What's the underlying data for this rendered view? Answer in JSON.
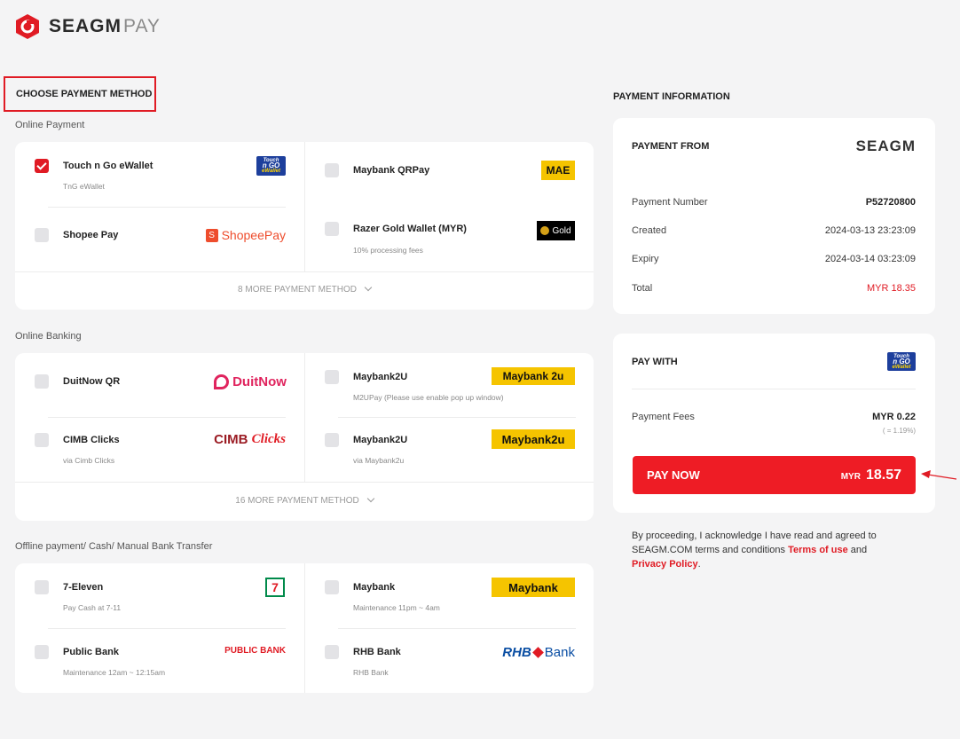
{
  "brand": {
    "logo_main": "SEAGM",
    "logo_pay": "PAY"
  },
  "left": {
    "choose_title": "CHOOSE PAYMENT METHOD",
    "online_payment": {
      "label": "Online Payment",
      "options": [
        {
          "name": "Touch n Go eWallet",
          "sub": "TnG eWallet",
          "checked": true,
          "logo": "Touch n GO eWallet"
        },
        {
          "name": "Maybank QRPay",
          "sub": "",
          "checked": false,
          "logo": "MAE"
        },
        {
          "name": "Shopee Pay",
          "sub": "",
          "checked": false,
          "logo": "ShopeePay"
        },
        {
          "name": "Razer Gold Wallet (MYR)",
          "sub": "10% processing fees",
          "checked": false,
          "logo": "Gold"
        }
      ],
      "more": "8 MORE PAYMENT METHOD"
    },
    "online_banking": {
      "label": "Online Banking",
      "options": [
        {
          "name": "DuitNow QR",
          "sub": "",
          "logo": "DuitNow"
        },
        {
          "name": "Maybank2U",
          "sub": "M2UPay (Please use enable pop up window)",
          "logo": "Maybank 2u"
        },
        {
          "name": "CIMB Clicks",
          "sub": "via Cimb Clicks",
          "logo_a": "CIMB",
          "logo_b": "Clicks"
        },
        {
          "name": "Maybank2U",
          "sub": "via Maybank2u",
          "logo": "Maybank2u"
        }
      ],
      "more": "16 MORE PAYMENT METHOD"
    },
    "offline": {
      "label": "Offline payment/ Cash/ Manual Bank Transfer",
      "options": [
        {
          "name": "7-Eleven",
          "sub": "Pay Cash at 7-11",
          "logo": "7"
        },
        {
          "name": "Maybank",
          "sub": "Maintenance 11pm ~ 4am",
          "logo": "Maybank"
        },
        {
          "name": "Public Bank",
          "sub": "Maintenance 12am ~ 12:15am",
          "logo": "PUBLIC BANK"
        },
        {
          "name": "RHB Bank",
          "sub": "RHB Bank",
          "logo_a": "RHB",
          "logo_b": "Bank"
        }
      ]
    }
  },
  "right": {
    "title": "PAYMENT INFORMATION",
    "from_label": "PAYMENT FROM",
    "from_logo": "SEAGM",
    "rows": [
      {
        "label": "Payment Number",
        "value": "P52720800"
      },
      {
        "label": "Created",
        "value": "2024-03-13 23:23:09"
      },
      {
        "label": "Expiry",
        "value": "2024-03-14 03:23:09"
      },
      {
        "label": "Total",
        "value": "MYR 18.35"
      }
    ],
    "pay_with_label": "PAY WITH",
    "fees_label": "Payment Fees",
    "fees_value": "MYR 0.22",
    "fees_pct": "( = 1.19%)",
    "pay_now_label": "PAY NOW",
    "pay_now_currency": "MYR",
    "pay_now_amount": "18.57",
    "terms_text": "By proceeding, I acknowledge I have read and agreed to SEAGM.COM terms and conditions ",
    "terms_link": "Terms of use",
    "terms_and": " and ",
    "privacy_link": "Privacy Policy",
    "terms_end": "."
  },
  "colors": {
    "accent": "#e01b24",
    "background": "#f4f4f5",
    "card": "#ffffff"
  }
}
